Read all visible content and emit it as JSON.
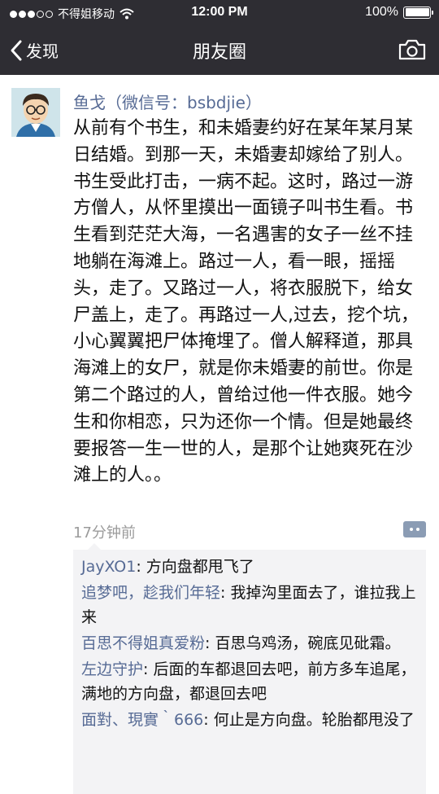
{
  "status_bar": {
    "carrier": "不得姐移动",
    "time": "12:00 PM",
    "battery": "100%",
    "battery_level": 1.0,
    "signal_bars_filled": 3,
    "signal_bars_total": 5
  },
  "nav": {
    "back_label": "发现",
    "title": "朋友圈",
    "back_icon": "chevron-left-icon",
    "camera_icon": "camera-icon"
  },
  "post": {
    "author": "鱼戈（微信号：bsbdjie）",
    "text": "从前有个书生，和未婚妻约好在某年某月某日结婚。到那一天，未婚妻却嫁给了别人。书生受此打击，一病不起。这时，路过一游方僧人，从怀里摸出一面镜子叫书生看。书生看到茫茫大海，一名遇害的女子一丝不挂地躺在海滩上。路过一人，看一眼，摇摇头，走了。又路过一人，将衣服脱下，给女尸盖上，走了。再路过一人,过去，挖个坑，小心翼翼把尸体掩埋了。僧人解释道，那具海滩上的女尸，就是你未婚妻的前世。你是第二个路过的人，曾给过他一件衣服。她今生和你相恋，只为还你一个情。但是她最终要报答一生一世的人，是那个让她爽死在沙滩上的人。。",
    "time_ago": "17分钟前"
  },
  "comments": [
    {
      "name": "JayXO1",
      "text": "方向盘都甩飞了"
    },
    {
      "name": "追梦吧，趁我们年轻",
      "text": "我掉沟里面去了，谁拉我上来"
    },
    {
      "name": "百思不得姐真爱粉",
      "text": "百思乌鸡汤，碗底见砒霜。"
    },
    {
      "name": "左边守护",
      "text": "后面的车都退回去吧，前方多车追尾，满地的方向盘，都退回去吧"
    },
    {
      "name": "面對、現實｀666",
      "text": "何止是方向盘。轮胎都甩没了"
    }
  ],
  "colors": {
    "bar_bg": "#2e2d33",
    "link": "#576b95",
    "comment_bg": "#f3f3f5"
  }
}
